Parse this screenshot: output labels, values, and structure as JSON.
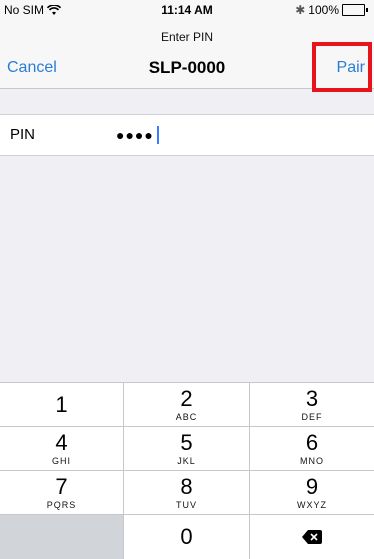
{
  "status_bar": {
    "carrier": "No SIM",
    "time": "11:14 AM",
    "battery": "100%"
  },
  "nav": {
    "prompt": "Enter PIN",
    "title": "SLP-0000",
    "cancel_label": "Cancel",
    "pair_label": "Pair"
  },
  "pin": {
    "label": "PIN",
    "value_masked": "●●●●"
  },
  "keypad": {
    "keys": [
      {
        "digit": "1",
        "letters": ""
      },
      {
        "digit": "2",
        "letters": "ABC"
      },
      {
        "digit": "3",
        "letters": "DEF"
      },
      {
        "digit": "4",
        "letters": "GHI"
      },
      {
        "digit": "5",
        "letters": "JKL"
      },
      {
        "digit": "6",
        "letters": "MNO"
      },
      {
        "digit": "7",
        "letters": "PQRS"
      },
      {
        "digit": "8",
        "letters": "TUV"
      },
      {
        "digit": "9",
        "letters": "WXYZ"
      },
      {
        "digit": "0",
        "letters": ""
      }
    ]
  },
  "colors": {
    "accent": "#2a7dd4",
    "highlight": "#e8141b",
    "background": "#efeff4"
  }
}
